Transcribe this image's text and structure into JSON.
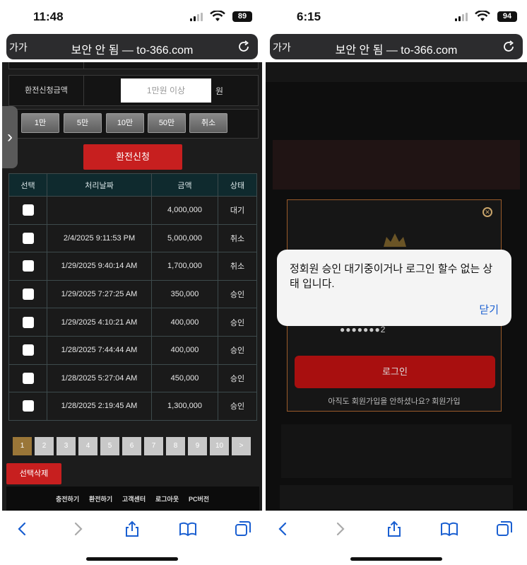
{
  "left": {
    "status": {
      "time": "11:48",
      "battery": "89"
    },
    "url": {
      "aa": "가가",
      "text": "보안 안 됨 — to-366.com"
    },
    "form": {
      "label": "환전신청금액",
      "placeholder": "1만원 이상",
      "unit": "원"
    },
    "chips": [
      "1만",
      "5만",
      "10만",
      "50만",
      "취소"
    ],
    "exchange_button": "환전신청",
    "table": {
      "headers": [
        "선택",
        "처리날짜",
        "금액",
        "상태"
      ],
      "rows": [
        {
          "date": "",
          "amount": "4,000,000",
          "status": "대기"
        },
        {
          "date": "2/4/2025 9:11:53 PM",
          "amount": "5,000,000",
          "status": "취소"
        },
        {
          "date": "1/29/2025 9:40:14 AM",
          "amount": "1,700,000",
          "status": "취소"
        },
        {
          "date": "1/29/2025 7:27:25 AM",
          "amount": "350,000",
          "status": "승인"
        },
        {
          "date": "1/29/2025 4:10:21 AM",
          "amount": "400,000",
          "status": "승인"
        },
        {
          "date": "1/28/2025 7:44:44 AM",
          "amount": "400,000",
          "status": "승인"
        },
        {
          "date": "1/28/2025 5:27:04 AM",
          "amount": "450,000",
          "status": "승인"
        },
        {
          "date": "1/28/2025 2:19:45 AM",
          "amount": "1,300,000",
          "status": "승인"
        }
      ]
    },
    "pages": [
      "1",
      "2",
      "3",
      "4",
      "5",
      "6",
      "7",
      "8",
      "9",
      "10",
      ">"
    ],
    "delete_button": "선택삭제",
    "footer_links": [
      "충전하기",
      "환전하기",
      "고객센터",
      "로그아웃",
      "PC버전"
    ]
  },
  "right": {
    "status": {
      "time": "6:15",
      "battery": "94"
    },
    "url": {
      "aa": "가가",
      "text": "보안 안 됨 — to-366.com"
    },
    "password_mask": "●●●●●●●2",
    "login_button": "로그인",
    "signup_note": "아직도 회원가입을 안하셨나요? 회원가입",
    "alert": {
      "message": "정회원 승인 대기중이거나 로그인 할수 없는 상태 입니다.",
      "close": "닫기"
    }
  },
  "colors": {
    "accent_red": "#c71f1f",
    "active_page": "#9a7638",
    "alert_link": "#1a5fd1"
  }
}
